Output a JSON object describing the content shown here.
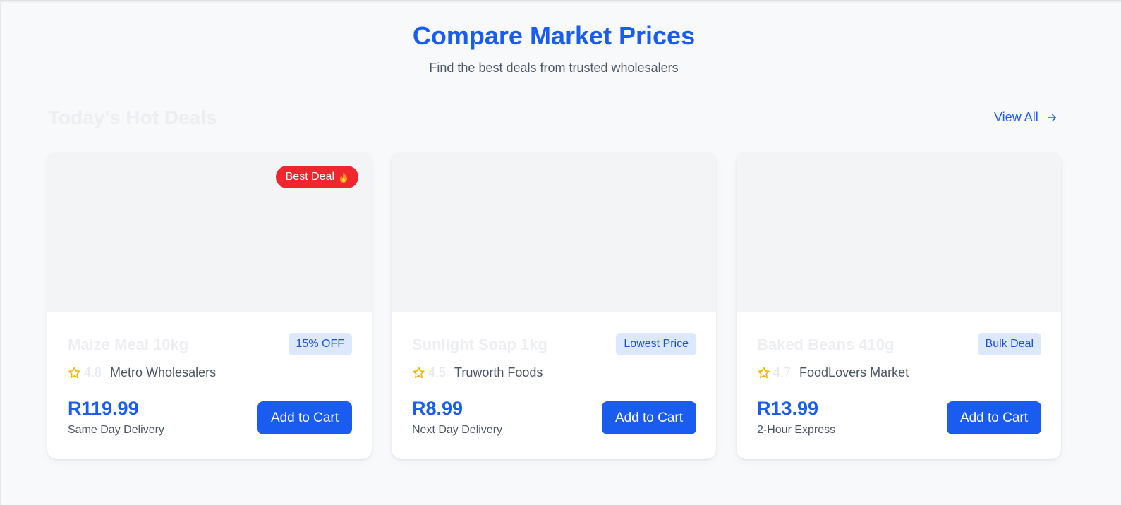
{
  "header": {
    "title": "Compare Market Prices",
    "subtitle": "Find the best deals from trusted wholesalers"
  },
  "section": {
    "title": "Today's Hot Deals",
    "view_all": "View All"
  },
  "colors": {
    "accent": "#1a5cf0",
    "badge_red": "#f0262f",
    "tag_bg": "#dbe8fd",
    "star": "#f5b400"
  },
  "cards": [
    {
      "hot_badge": "Best Deal",
      "hot_badge_icon": "flame-icon",
      "name": "Maize Meal 10kg",
      "tag": "15% OFF",
      "rating": "4.8",
      "seller": "Metro Wholesalers",
      "price": "R119.99",
      "delivery": "Same Day Delivery",
      "button": "Add to Cart"
    },
    {
      "name": "Sunlight Soap 1kg",
      "tag": "Lowest Price",
      "rating": "4.5",
      "seller": "Truworth Foods",
      "price": "R8.99",
      "delivery": "Next Day Delivery",
      "button": "Add to Cart"
    },
    {
      "name": "Baked Beans 410g",
      "tag": "Bulk Deal",
      "rating": "4.7",
      "seller": "FoodLovers Market",
      "price": "R13.99",
      "delivery": "2-Hour Express",
      "button": "Add to Cart"
    }
  ]
}
